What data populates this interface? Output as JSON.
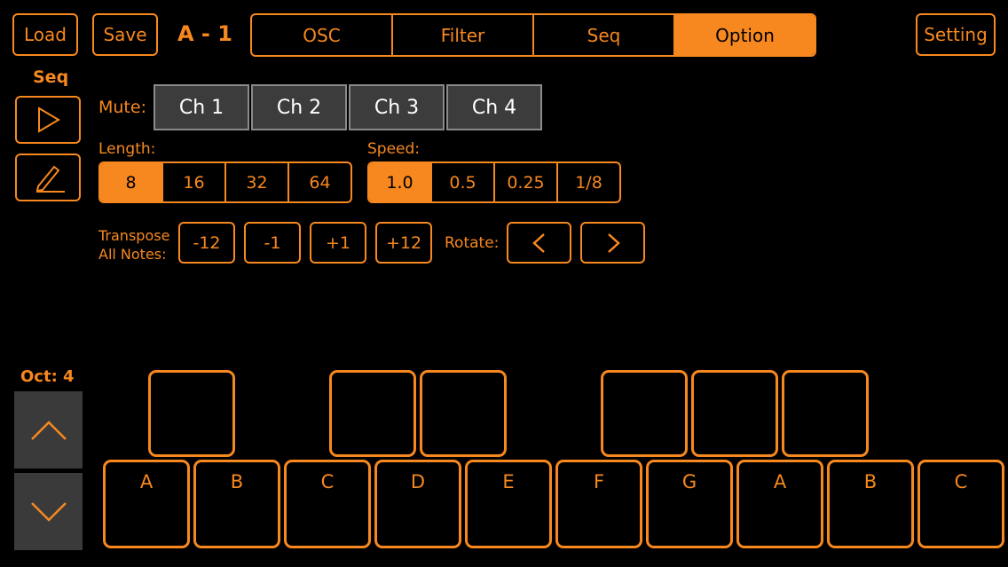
{
  "header": {
    "load_label": "Load",
    "save_label": "Save",
    "patch_title": "A - 1",
    "tabs": [
      {
        "label": "OSC",
        "active": false
      },
      {
        "label": "Filter",
        "active": false
      },
      {
        "label": "Seq",
        "active": false
      },
      {
        "label": "Option",
        "active": true
      }
    ],
    "setting_label": "Setting"
  },
  "sidebar": {
    "seq_label": "Seq",
    "play_icon": "play-icon",
    "edit_icon": "pencil-icon",
    "octave_label": "Oct: 4"
  },
  "mute": {
    "label": "Mute:",
    "channels": [
      "Ch 1",
      "Ch 2",
      "Ch 3",
      "Ch 4"
    ]
  },
  "length": {
    "label": "Length:",
    "options": [
      "8",
      "16",
      "32",
      "64"
    ],
    "selected": "8"
  },
  "speed": {
    "label": "Speed:",
    "options": [
      "1.0",
      "0.5",
      "0.25",
      "1/8"
    ],
    "selected": "1.0"
  },
  "transpose": {
    "label_line1": "Transpose",
    "label_line2": "All Notes:",
    "buttons": [
      "-12",
      "-1",
      "+1",
      "+12"
    ]
  },
  "rotate": {
    "label": "Rotate:",
    "left_icon": "chevron-left-icon",
    "right_icon": "chevron-right-icon"
  },
  "keyboard": {
    "white_keys": [
      "A",
      "B",
      "C",
      "D",
      "E",
      "F",
      "G",
      "A",
      "B",
      "C"
    ]
  },
  "colors": {
    "accent": "#f7881f",
    "background": "#000000",
    "mute_button": "#3c3c3c"
  }
}
